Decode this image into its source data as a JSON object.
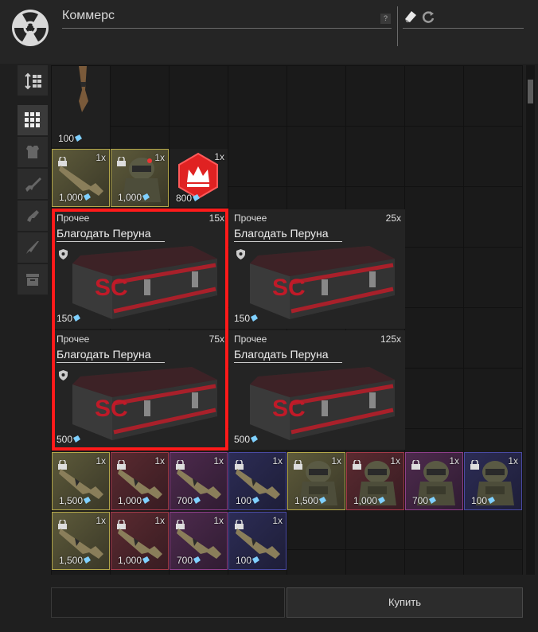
{
  "header": {
    "title": "Коммерс",
    "help_label": "?"
  },
  "sidebar": {
    "items": [
      {
        "icon": "sort-icon"
      },
      {
        "icon": "grid-icon"
      },
      {
        "icon": "armor-icon"
      },
      {
        "icon": "rifle-icon"
      },
      {
        "icon": "pistol-icon"
      },
      {
        "icon": "knife-icon"
      },
      {
        "icon": "box-icon"
      }
    ]
  },
  "grid": {
    "row0": [
      {
        "price": "100",
        "qty": "",
        "rarity": "plain",
        "icon": "knife-item-icon"
      }
    ],
    "row1": [
      {
        "price": "1,000",
        "qty": "1x",
        "rarity": "yellow",
        "icon": "rifle-item-icon"
      },
      {
        "price": "1,000",
        "qty": "1x",
        "rarity": "yellow",
        "icon": "helmet-item-icon"
      },
      {
        "price": "800",
        "qty": "1x",
        "rarity": "plain",
        "icon": "crown-badge-icon"
      }
    ],
    "boxes": [
      {
        "category": "Прочее",
        "name": "Благодать Перуна",
        "qty": "15x",
        "price": "150",
        "crate_text": "SC"
      },
      {
        "category": "Прочее",
        "name": "Благодать Перуна",
        "qty": "25x",
        "price": "150",
        "crate_text": "SC"
      },
      {
        "category": "Прочее",
        "name": "Благодать Перуна",
        "qty": "75x",
        "price": "500",
        "crate_text": "SC"
      },
      {
        "category": "Прочее",
        "name": "Благодать Перуна",
        "qty": "125x",
        "price": "500",
        "crate_text": "SC"
      }
    ],
    "row_items_a": [
      {
        "price": "1,500",
        "qty": "1x",
        "rarity": "yellow",
        "icon": "rifle-item-icon"
      },
      {
        "price": "1,000",
        "qty": "1x",
        "rarity": "red",
        "icon": "rifle-item-icon"
      },
      {
        "price": "700",
        "qty": "1x",
        "rarity": "purple",
        "icon": "rifle-item-icon"
      },
      {
        "price": "100",
        "qty": "1x",
        "rarity": "blue",
        "icon": "rifle-item-icon"
      },
      {
        "price": "1,500",
        "qty": "1x",
        "rarity": "yellow",
        "icon": "armor-item-icon"
      },
      {
        "price": "1,000",
        "qty": "1x",
        "rarity": "red",
        "icon": "armor-item-icon"
      },
      {
        "price": "700",
        "qty": "1x",
        "rarity": "purple",
        "icon": "armor-item-icon"
      },
      {
        "price": "100",
        "qty": "1x",
        "rarity": "blue",
        "icon": "armor-item-icon"
      }
    ],
    "row_items_b": [
      {
        "price": "1,500",
        "qty": "1x",
        "rarity": "yellow",
        "icon": "rifle-item-icon"
      },
      {
        "price": "1,000",
        "qty": "1x",
        "rarity": "red",
        "icon": "rifle-item-icon"
      },
      {
        "price": "700",
        "qty": "1x",
        "rarity": "purple",
        "icon": "rifle-item-icon"
      },
      {
        "price": "100",
        "qty": "1x",
        "rarity": "blue",
        "icon": "rifle-item-icon"
      }
    ]
  },
  "footer": {
    "buy_label": "Купить"
  },
  "colors": {
    "accent_red": "#ff1a1a",
    "yellow": "#b5a84a",
    "red": "#a33a4a",
    "purple": "#8e3e8a",
    "blue": "#4a4aa3"
  }
}
